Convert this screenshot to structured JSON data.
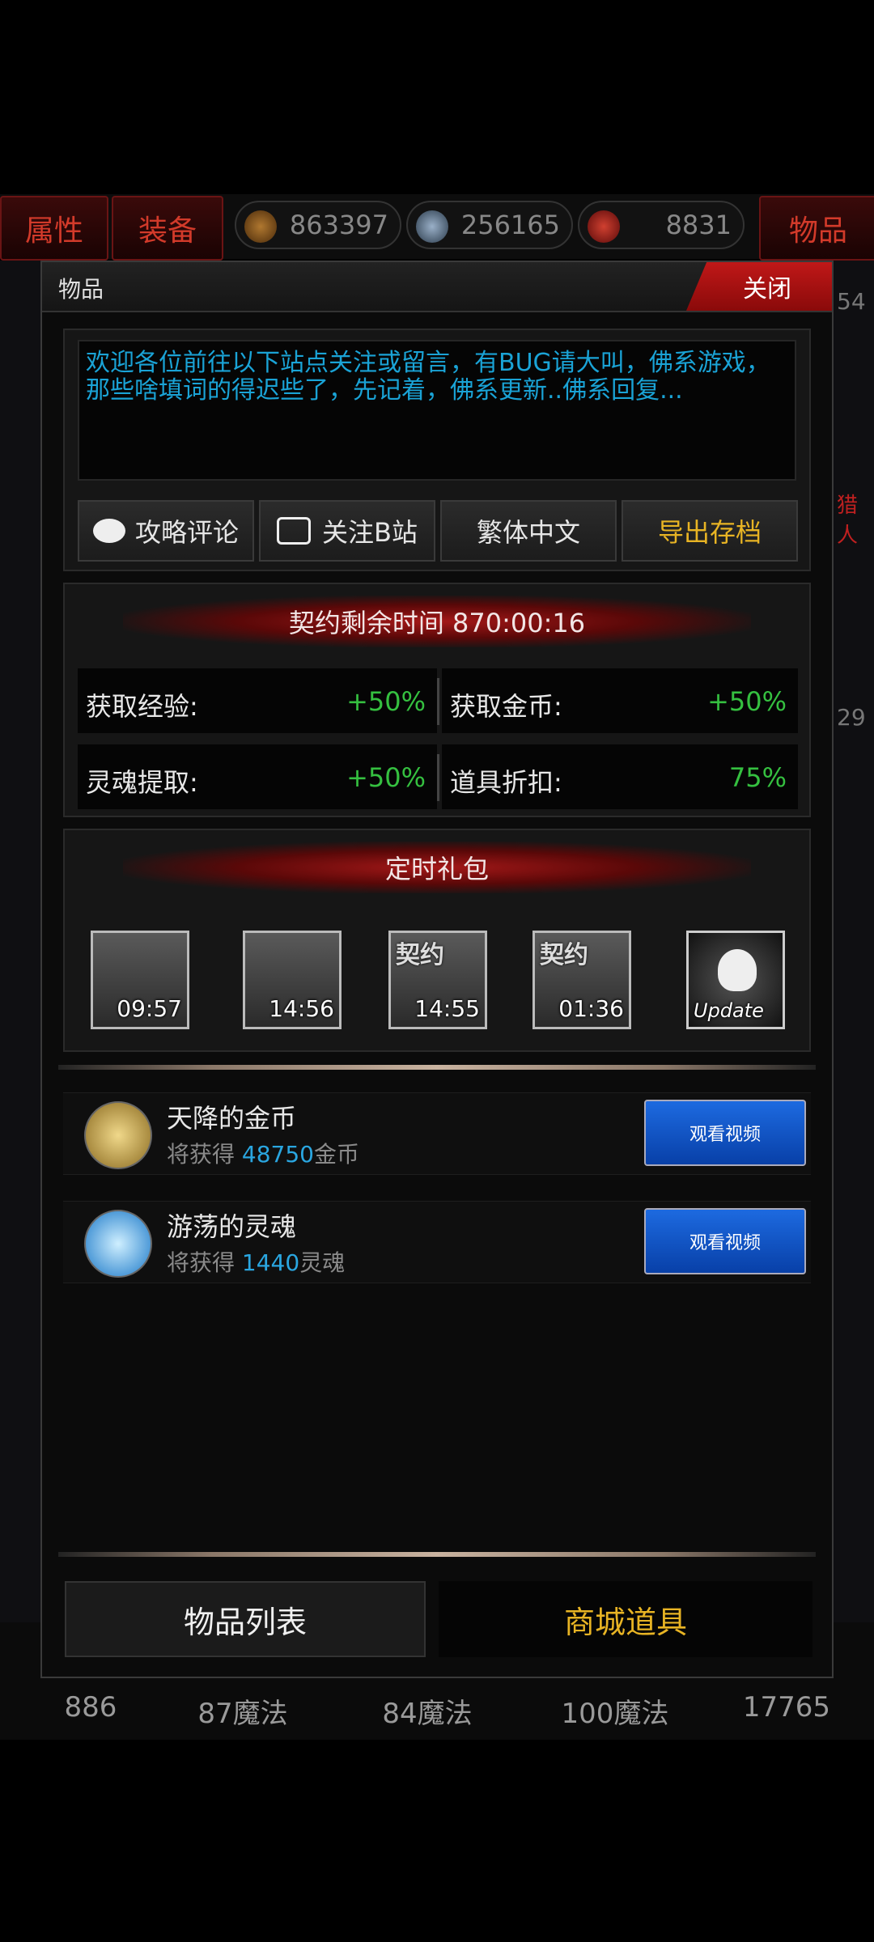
{
  "topbar": {
    "tab_attributes": "属性",
    "tab_equipment": "装备",
    "tab_items": "物品",
    "resources": [
      {
        "value": "863397",
        "icon": "bronze-coin-icon"
      },
      {
        "value": "256165",
        "icon": "skull-soul-icon"
      },
      {
        "value": "8831",
        "icon": "red-gem-icon"
      }
    ]
  },
  "background": {
    "side_right_top": "54",
    "side_right_text": "猎人",
    "side_right_mid": "29",
    "bottom_values": [
      "886",
      "87魔法",
      "84魔法",
      "100魔法",
      "17765"
    ]
  },
  "dialog": {
    "title": "物品",
    "close_label": "关闭",
    "notice": "欢迎各位前往以下站点关注或留言，有BUG请大叫，佛系游戏，那些啥填词的得迟些了，先记着，佛系更新..佛系回复...",
    "links": {
      "review": "攻略评论",
      "bilibili": "关注B站",
      "traditional": "繁体中文",
      "export": "导出存档"
    },
    "contract": {
      "title": "契约剩余时间 870:00:16",
      "stats": [
        {
          "label": "获取经验:",
          "value": "+50%"
        },
        {
          "label": "获取金币:",
          "value": "+50%"
        },
        {
          "label": "灵魂提取:",
          "value": "+50%"
        },
        {
          "label": "道具折扣:",
          "value": "75%"
        }
      ]
    },
    "gifts": {
      "title": "定时礼包",
      "items": [
        {
          "tag": "",
          "time": "09:57"
        },
        {
          "tag": "",
          "time": "14:56"
        },
        {
          "tag": "契约",
          "time": "14:55"
        },
        {
          "tag": "契约",
          "time": "01:36"
        },
        {
          "tag": "",
          "time": "Update"
        }
      ]
    },
    "rewards": [
      {
        "title": "天降的金币",
        "prefix": "将获得",
        "amount": "48750",
        "unit": "金币",
        "button": "观看视频"
      },
      {
        "title": "游荡的灵魂",
        "prefix": "将获得",
        "amount": "1440",
        "unit": "灵魂",
        "button": "观看视频"
      }
    ],
    "tabs": {
      "item_list": "物品列表",
      "shop_items": "商城道具"
    },
    "colors": {
      "accent_red": "#c01818",
      "stat_green": "#35c040",
      "notice_blue": "#1aa3d6",
      "shop_gold": "#e8b424"
    }
  }
}
